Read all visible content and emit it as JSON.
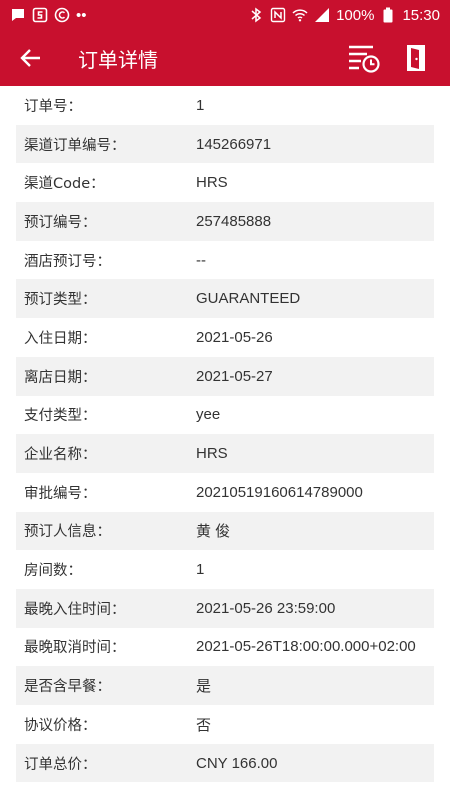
{
  "status_bar": {
    "battery": "100%",
    "time": "15:30",
    "left_dots": "••",
    "icons": [
      "chat-icon",
      "s-square-icon",
      "circle-c-icon",
      "bluetooth-icon",
      "nfc-icon",
      "wifi-icon",
      "signal-icon",
      "battery-icon"
    ]
  },
  "header": {
    "title": "订单详情",
    "back_icon": "arrow-left-icon",
    "actions": [
      "filter-history-icon",
      "door-exit-icon"
    ]
  },
  "colors": {
    "brand": "#c8102e",
    "stripe": "#f2f2f2",
    "text": "#333333"
  },
  "rows": [
    {
      "label": "订单号：",
      "value": "1"
    },
    {
      "label": "渠道订单编号：",
      "value": "145266971"
    },
    {
      "label": "渠道Code：",
      "value": "HRS"
    },
    {
      "label": "预订编号：",
      "value": "257485888"
    },
    {
      "label": "酒店预订号：",
      "value": "--"
    },
    {
      "label": "预订类型：",
      "value": "GUARANTEED"
    },
    {
      "label": "入住日期：",
      "value": "2021-05-26"
    },
    {
      "label": "离店日期：",
      "value": "2021-05-27"
    },
    {
      "label": "支付类型：",
      "value": "yee"
    },
    {
      "label": "企业名称：",
      "value": "HRS"
    },
    {
      "label": "审批编号：",
      "value": "20210519160614789000"
    },
    {
      "label": "预订人信息：",
      "value": "黄 俊"
    },
    {
      "label": "房间数：",
      "value": "1"
    },
    {
      "label": "最晚入住时间：",
      "value": "2021-05-26 23:59:00"
    },
    {
      "label": "最晚取消时间：",
      "value": "2021-05-26T18:00:00.000+02:00"
    },
    {
      "label": "是否含早餐：",
      "value": "是"
    },
    {
      "label": "协议价格：",
      "value": "否"
    },
    {
      "label": "订单总价：",
      "value": "CNY 166.00"
    }
  ]
}
